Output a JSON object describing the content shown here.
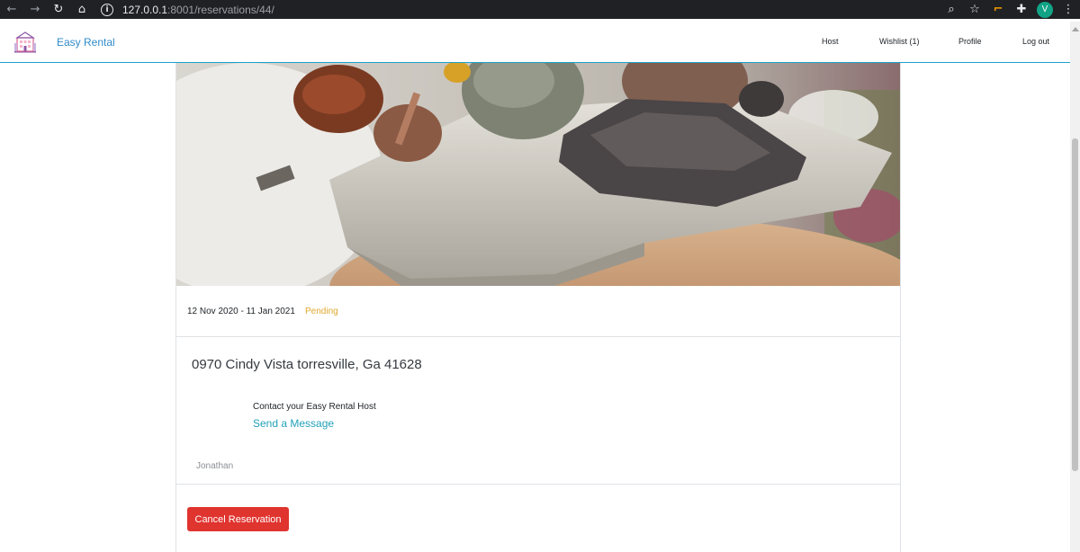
{
  "browser": {
    "url_host": "127.0.0.1",
    "url_rest": ":8001/reservations/44/",
    "profile_initial": "V"
  },
  "navbar": {
    "brand": "Easy Rental",
    "links": [
      "Host",
      "Wishlist (1)",
      "Profile",
      "Log out"
    ]
  },
  "reservation": {
    "dates": "12 Nov 2020 - 11 Jan 2021",
    "status": "Pending",
    "address": "0970 Cindy Vista torresville, Ga 41628",
    "contact_label": "Contact your Easy Rental Host",
    "send_message": "Send a Message",
    "host_name": "Jonathan",
    "cancel_label": "Cancel Reservation"
  },
  "colors": {
    "brand_blue": "#2f8bc9",
    "status_pending": "#e0a82e",
    "link_teal": "#22a2b8",
    "danger": "#e0342f"
  }
}
